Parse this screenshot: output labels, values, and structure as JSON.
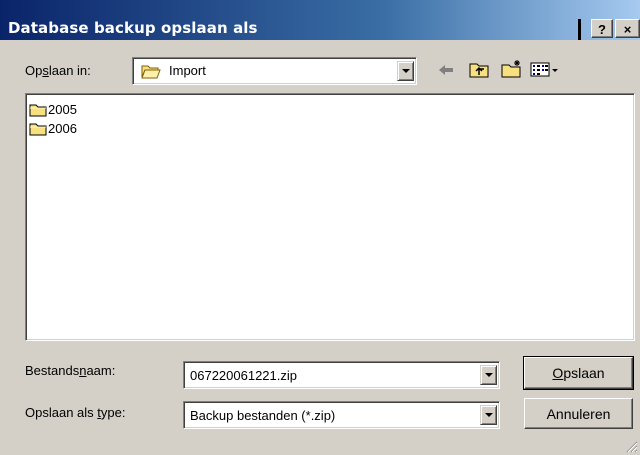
{
  "window": {
    "title": "Database backup opslaan als",
    "help_label": "?",
    "close_label": "×"
  },
  "location": {
    "label_pre": "Op",
    "label_ul": "s",
    "label_post": "laan in:",
    "value": "Import"
  },
  "toolbar": {
    "icons": [
      "back-arrow-icon",
      "up-folder-icon",
      "new-folder-icon",
      "view-menu-icon"
    ]
  },
  "files": [
    {
      "name": "2005",
      "icon": "folder-icon"
    },
    {
      "name": "2006",
      "icon": "folder-icon"
    }
  ],
  "filename": {
    "label_pre": "Bestands",
    "label_ul": "n",
    "label_post": "aam:",
    "value": "067220061221.zip"
  },
  "filetype": {
    "label_pre": "Opslaan als ",
    "label_ul": "t",
    "label_post": "ype:",
    "value": "Backup bestanden (*.zip)"
  },
  "buttons": {
    "save_ul": "O",
    "save_rest": "pslaan",
    "cancel": "Annuleren"
  },
  "colors": {
    "title_start": "#0a246a",
    "title_end": "#a6caf0",
    "face": "#d4d0c8",
    "folder": "#f8e080"
  }
}
